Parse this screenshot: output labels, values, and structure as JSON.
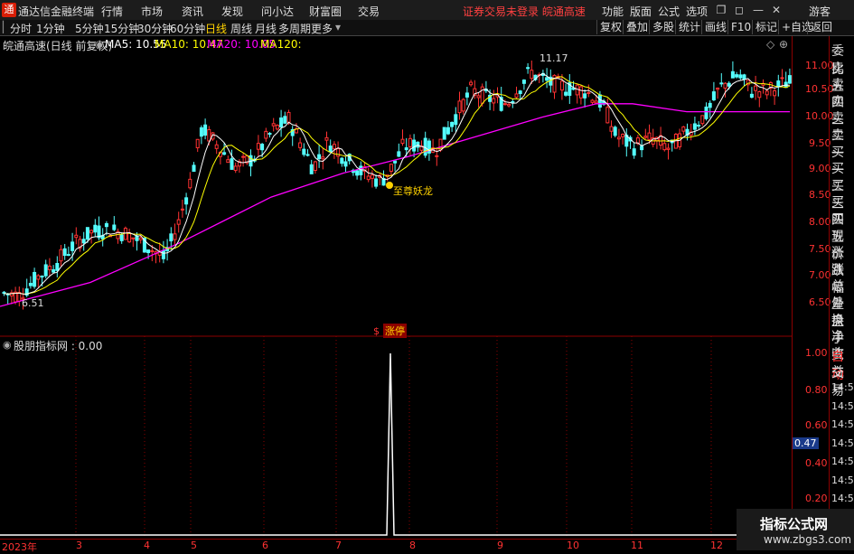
{
  "app": {
    "title": "通达信金融终端",
    "notice": "证券交易未登录  皖通高速",
    "user": "游客"
  },
  "menus": [
    "行情",
    "市场",
    "资讯",
    "发现",
    "问小达",
    "财富圈",
    "交易"
  ],
  "rmenus": [
    "功能",
    "版面",
    "公式",
    "选项"
  ],
  "periods": [
    "分时",
    "1分钟",
    "5分钟",
    "15分钟",
    "30分钟",
    "60分钟",
    "日线",
    "周线",
    "月线",
    "多周期",
    "更多"
  ],
  "active_period": "日线",
  "rtools": [
    "复权",
    "叠加",
    "多股",
    "统计",
    "画线",
    "F10",
    "标记",
    "+自选",
    "返回"
  ],
  "info": {
    "stock": "皖通高速(日线 前复权)",
    "ma5": "MA5: 10.55",
    "ma10": "MA10: 10.47",
    "ma20": "MA20: 10.05",
    "ma120": "MA120:"
  },
  "price_axis": [
    "11.00",
    "10.50",
    "10.00",
    "9.50",
    "9.00",
    "8.50",
    "8.00",
    "7.50",
    "7.00",
    "6.50"
  ],
  "annotations": {
    "high": "11.17",
    "low": "6.51",
    "signal": "至尊妖龙",
    "zhangting": "涨停"
  },
  "indicator": {
    "label": "股朋指标网 : 0.00",
    "axis": [
      "1.00",
      "0.80",
      "0.60",
      "0.40",
      "0.20"
    ],
    "current": "0.47"
  },
  "months": [
    "2023年",
    "3",
    "4",
    "5",
    "6",
    "7",
    "8",
    "9",
    "10",
    "11",
    "12"
  ],
  "rightpanel": [
    "委比",
    "卖五",
    "卖四",
    "卖三",
    "卖二",
    "卖一",
    "买一",
    "买二",
    "买三",
    "买四",
    "买五",
    "现价",
    "涨跌",
    "涨幅",
    "总量",
    "外盘",
    "换手",
    "净资",
    "收益",
    "自动",
    "交易",
    "14:56",
    "14:56",
    "14:56",
    "14:56",
    "14:56",
    "14:56",
    "14:56",
    "14:56"
  ],
  "watermark": {
    "line1": "指标公式网",
    "line2": "www.zbgs3.com"
  },
  "colors": {
    "up": "#ff3232",
    "down": "#54ffff",
    "ma5": "#ffffff",
    "ma10": "#ffff00",
    "ma20": "#ff00ff",
    "ma120": "#00ff00",
    "grid": "#8b0000"
  }
}
